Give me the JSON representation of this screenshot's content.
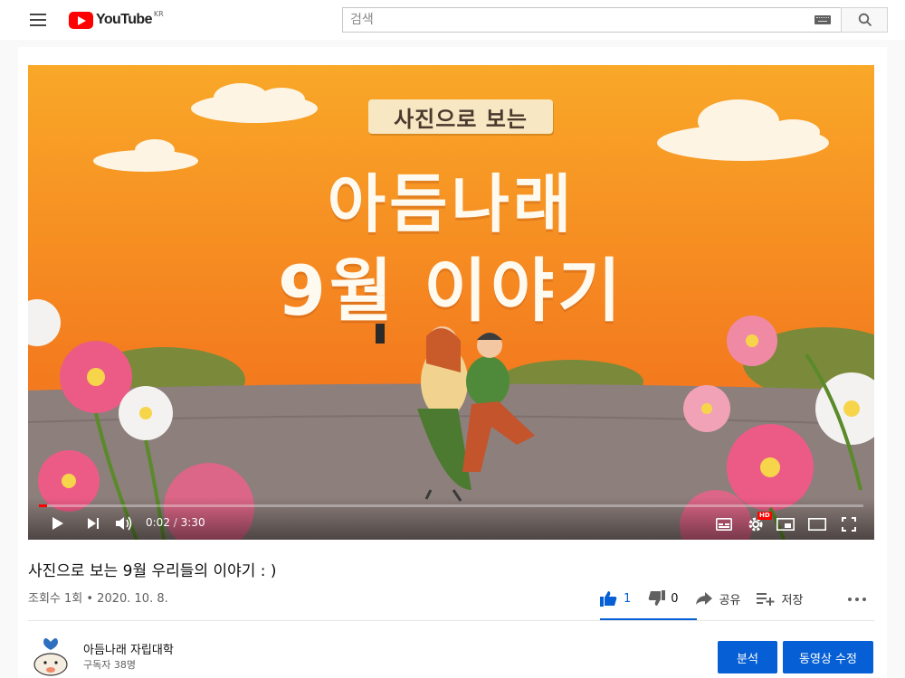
{
  "header": {
    "logo_text": "YouTube",
    "logo_region": "KR",
    "search_placeholder": "검색"
  },
  "video": {
    "title_box": "사진으로 보는",
    "title_line1": "아듬나래",
    "title_line2": "9월 이야기",
    "current_time": "0:02",
    "duration": "3:30",
    "progress_fraction": 0.0095,
    "hd_badge": "HD"
  },
  "info": {
    "title": "사진으로 보는 9월 우리들의 이야기 : )",
    "meta": "조회수 1회 • 2020. 10. 8.",
    "like_count": "1",
    "dislike_count": "0",
    "share_label": "공유",
    "save_label": "저장"
  },
  "channel": {
    "name": "아듬나래 자립대학",
    "subscribers": "구독자 38명",
    "analytics_label": "분석",
    "edit_label": "동영상 수정"
  },
  "colors": {
    "brand_red": "#ff0000",
    "accent_blue": "#065fd4",
    "video_orange": "#f48d20"
  }
}
